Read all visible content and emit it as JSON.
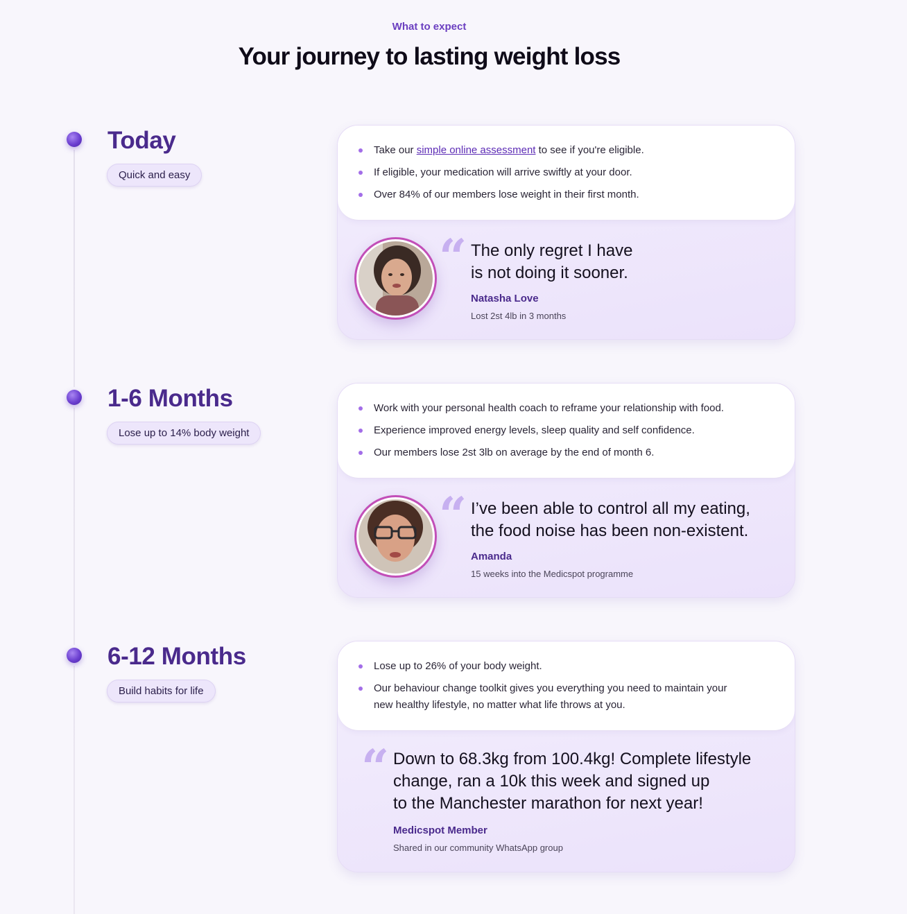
{
  "header": {
    "eyebrow": "What to expect",
    "title": "Your journey to lasting weight loss"
  },
  "stages": [
    {
      "title": "Today",
      "pill": "Quick and easy",
      "bullets": {
        "b0_pre": "Take our ",
        "b0_link": "simple online assessment",
        "b0_post": " to see if you're eligible.",
        "b1": "If eligible, your medication will arrive swiftly at your door.",
        "b2": "Over 84% of our members lose weight in their first month."
      },
      "quote": {
        "line1": "The only regret I have",
        "line2": "is not doing it sooner.",
        "name": "Natasha Love",
        "meta": "Lost 2st 4lb in 3 months"
      }
    },
    {
      "title": "1-6 Months",
      "pill": "Lose up to 14% body weight",
      "bullets": {
        "b0": "Work with your personal health coach to reframe your relationship with food.",
        "b1": "Experience improved energy levels, sleep quality and self confidence.",
        "b2": "Our members lose 2st 3lb on average by the end of month 6."
      },
      "quote": {
        "line1": "I’ve been able to control all my eating,",
        "line2": "the food noise has been non-existent.",
        "name": "Amanda",
        "meta": "15 weeks into the Medicspot programme"
      }
    },
    {
      "title": "6-12 Months",
      "pill": "Build habits for life",
      "bullets": {
        "b0": "Lose up to 26% of your body weight.",
        "b1_line1": "Our behaviour change toolkit gives you everything you need to maintain your",
        "b1_line2": "new healthy lifestyle, no matter what life throws at you."
      },
      "quote": {
        "line1": "Down to 68.3kg from 100.4kg! Complete lifestyle",
        "line2": "change, ran a 10k this week and signed up",
        "line3": "to the Manchester marathon for next year!",
        "name": "Medicspot Member",
        "meta": "Shared in our community WhatsApp group"
      }
    }
  ],
  "colors": {
    "accent": "#4a2a8c",
    "link": "#5c2bb5",
    "bullet": "#a36ee8",
    "avatar_ring": "#c24fb8"
  }
}
